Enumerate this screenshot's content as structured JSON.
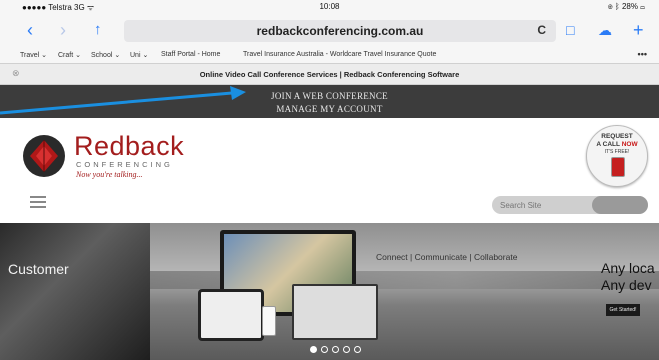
{
  "status_bar": {
    "carrier": "●●●●● Telstra  3G  ᯤ",
    "time": "10:08",
    "battery": "⊛ ᛒ 28% ▭"
  },
  "toolbar": {
    "url": "redbackconferencing.com.au"
  },
  "bookmarks": [
    {
      "label": "Travel ⌄"
    },
    {
      "label": "Craft ⌄"
    },
    {
      "label": "School ⌄"
    },
    {
      "label": "Uni ⌄"
    },
    {
      "label": "Staff Portal - Home"
    },
    {
      "label": "Travel Insurance Australia - Worldcare Travel Insurance Quote"
    }
  ],
  "tab": {
    "title": "Online Video Call Conference Services | Redback Conferencing Software"
  },
  "top_links": {
    "join": "JOIN A WEB CONFERENCE",
    "manage": "MANAGE MY ACCOUNT"
  },
  "header": {
    "brand": "Redback",
    "brand_sub": "CONFERENCING",
    "tagline": "Now you're talking...",
    "call_line1": "REQUEST",
    "call_line2a": "A CALL ",
    "call_line2b": "NOW",
    "call_line3": "IT'S FREE!",
    "search_placeholder": "Search Site"
  },
  "hero": {
    "customer": "Customer",
    "tagline": "Connect | Communicate | Collaborate",
    "any_line1": "Any loca",
    "any_line2": "Any dev",
    "cta": "Get Started!",
    "active_slide": 1,
    "slide_count": 5
  },
  "colors": {
    "brand_red": "#a31d1d",
    "safari_blue": "#2b7cf6",
    "annotation_arrow": "#1a8fe0"
  }
}
